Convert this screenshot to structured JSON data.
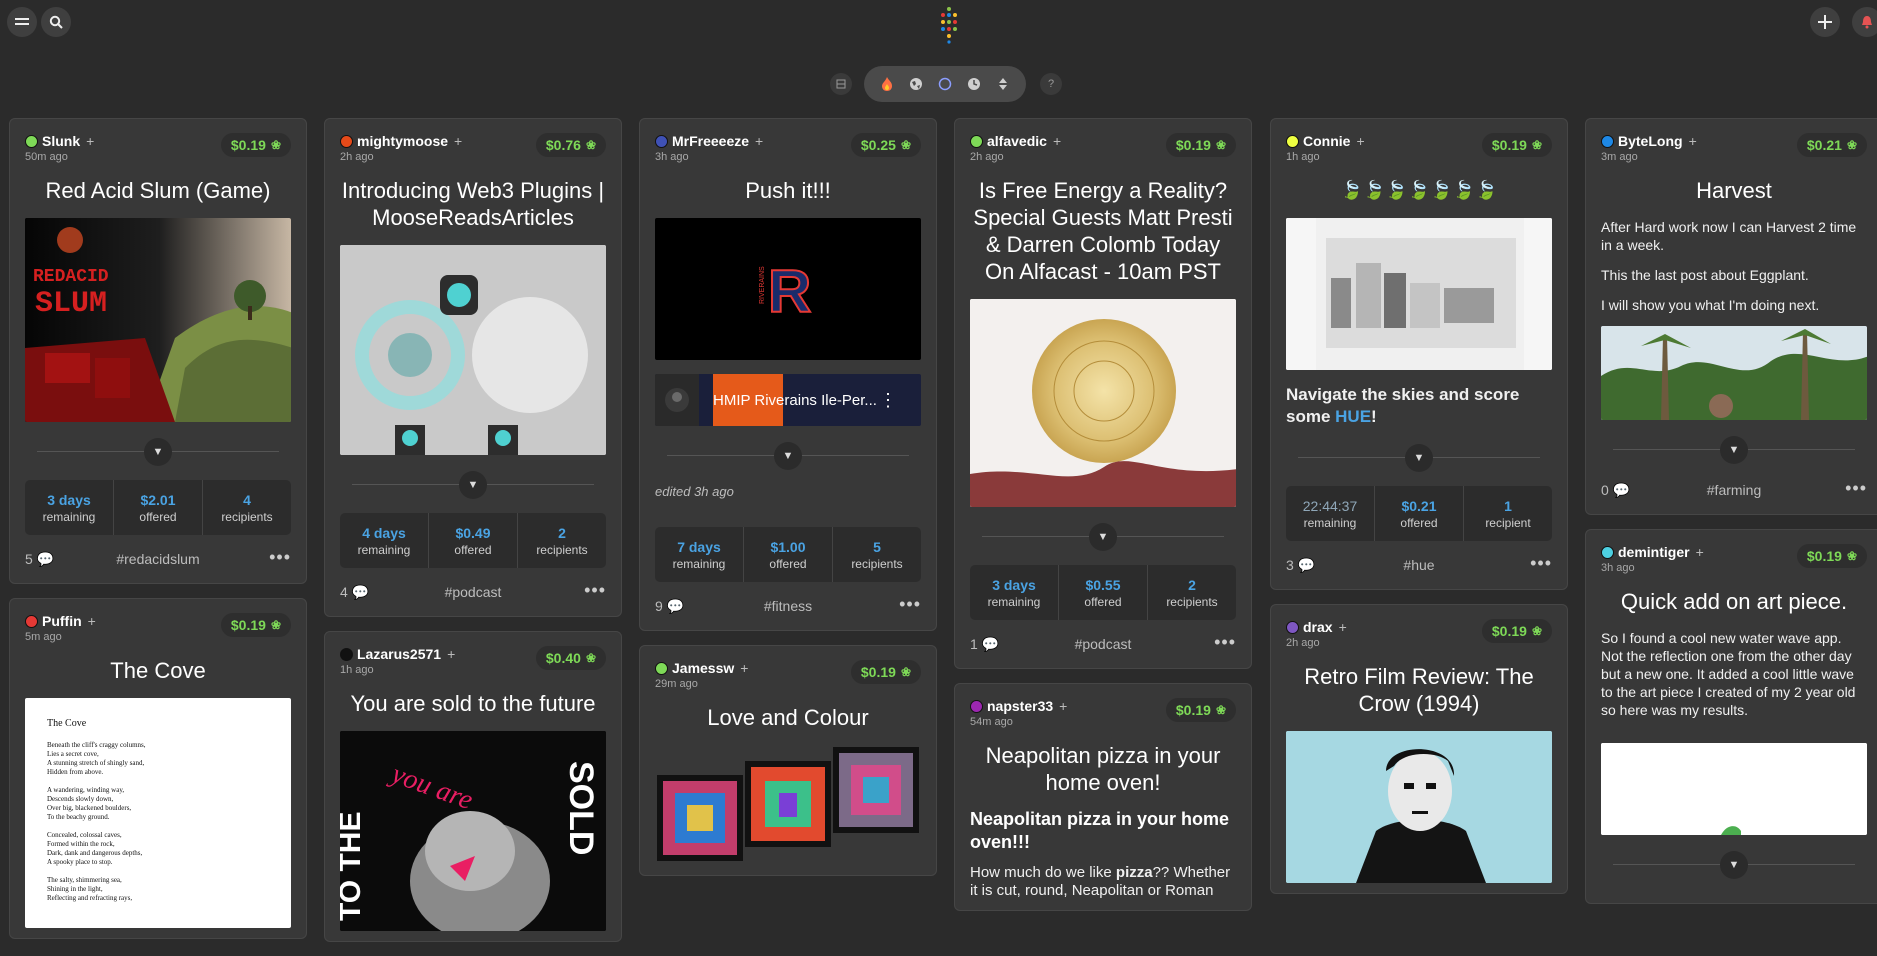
{
  "topbar": {
    "menu_icon": "menu-icon",
    "search_icon": "search-icon",
    "add_icon": "plus-icon",
    "notify_icon": "bell-icon"
  },
  "filterbar": {
    "icons": [
      "layout-icon",
      "fire-icon",
      "globe-icon",
      "circle-icon",
      "clock-icon",
      "sort-icon",
      "help-icon"
    ],
    "help_label": "?"
  },
  "cards": {
    "slunk": {
      "user": "Slunk",
      "ago": "50m ago",
      "price": "$0.19",
      "title": "Red Acid Slum (Game)",
      "stats": [
        {
          "v": "3 days",
          "l": "remaining"
        },
        {
          "v": "$2.01",
          "l": "offered"
        },
        {
          "v": "4",
          "l": "recipients"
        }
      ],
      "comments": "5",
      "tag": "#redacidslum",
      "media_text": "REDACID\nSLUM",
      "color": "#7ed957"
    },
    "puffin": {
      "user": "Puffin",
      "ago": "5m ago",
      "price": "$0.19",
      "title": "The Cove",
      "color": "#e53935",
      "poem_title": "The Cove",
      "poem": "Beneath the cliff's craggy columns,\nLies a secret cove,\nA stunning stretch of shingly sand,\nHidden from above.\n\nA wandering, winding way,\nDescends slowly down,\nOver big, blackened boulders,\nTo the beachy ground.\n\nConcealed, colossal caves,\nFormed within the rock,\nDark, dank and dangerous depths,\nA spooky place to stop.\n\nThe salty, shimmering sea,\nShining in the light,\nReflecting and refracting rays,"
    },
    "moose": {
      "user": "mightymoose",
      "ago": "2h ago",
      "price": "$0.76",
      "title": "Introducing Web3 Plugins | MooseReadsArticles",
      "stats": [
        {
          "v": "4 days",
          "l": "remaining"
        },
        {
          "v": "$0.49",
          "l": "offered"
        },
        {
          "v": "2",
          "l": "recipients"
        }
      ],
      "comments": "4",
      "tag": "#podcast",
      "color": "#e64a19"
    },
    "lazarus": {
      "user": "Lazarus2571",
      "ago": "1h ago",
      "price": "$0.40",
      "title": "You are sold to the future",
      "color": "#111111",
      "art_text": "SOLD",
      "art_text2": "TO THE",
      "art_script": "you are"
    },
    "freeze": {
      "user": "MrFreeeeze",
      "ago": "3h ago",
      "price": "$0.25",
      "title": "Push it!!!",
      "video_title": "HMIP Riverains Ile-Per...",
      "badge_letter": "R",
      "badge_text": "RIVERAINS",
      "edited": "edited 3h ago",
      "stats": [
        {
          "v": "7 days",
          "l": "remaining"
        },
        {
          "v": "$1.00",
          "l": "offered"
        },
        {
          "v": "5",
          "l": "recipients"
        }
      ],
      "comments": "9",
      "tag": "#fitness",
      "color": "#3f51b5"
    },
    "jamessw": {
      "user": "Jamessw",
      "ago": "29m ago",
      "price": "$0.19",
      "title": "Love and Colour",
      "color": "#7ed957"
    },
    "alfa": {
      "user": "alfavedic",
      "ago": "2h ago",
      "price": "$0.19",
      "title": "Is Free Energy a Reality? Special Guests Matt Presti & Darren Colomb Today On Alfacast - 10am PST",
      "stats": [
        {
          "v": "3 days",
          "l": "remaining"
        },
        {
          "v": "$0.55",
          "l": "offered"
        },
        {
          "v": "2",
          "l": "recipients"
        }
      ],
      "comments": "1",
      "tag": "#podcast",
      "color": "#7ed957"
    },
    "napster": {
      "user": "napster33",
      "ago": "54m ago",
      "price": "$0.19",
      "title": "Neapolitan pizza in your home oven!",
      "subtitle": "Neapolitan pizza in your home oven!!!",
      "body_pre": "How much do we like ",
      "body_bold": "pizza",
      "body_post": "?? Whether it is cut, round, Neapolitan or Roman",
      "color": "#9c27b0"
    },
    "connie": {
      "user": "Connie",
      "ago": "1h ago",
      "price": "$0.19",
      "title": "🍃🍃🍃🍃🍃🍃🍃",
      "body_pre": "Navigate the skies and score some ",
      "body_link": "HUE",
      "body_post": "!",
      "stats": [
        {
          "v": "22:44:37",
          "l": "remaining"
        },
        {
          "v": "$0.21",
          "l": "offered"
        },
        {
          "v": "1",
          "l": "recipient"
        }
      ],
      "comments": "3",
      "tag": "#hue",
      "color": "#eeff41"
    },
    "drax": {
      "user": "drax",
      "ago": "2h ago",
      "price": "$0.19",
      "title": "Retro Film Review: The Crow (1994)",
      "color": "#7e57c2"
    },
    "bytelong": {
      "user": "ByteLong",
      "ago": "3m ago",
      "price": "$0.21",
      "title": "Harvest",
      "paras": [
        "After Hard work now I can Harvest 2 time in a week.",
        "This the last post about Eggplant.",
        "I will show you what I'm doing next."
      ],
      "comments": "0",
      "tag": "#farming",
      "color": "#1e88e5"
    },
    "demintiger": {
      "user": "demintiger",
      "ago": "3h ago",
      "price": "$0.19",
      "title": "Quick add on art piece.",
      "body": "So I found a cool new water wave app. Not the reflection one from the other day but a new one. It added a cool little wave to the art piece I created of my 2 year old so here was my results.",
      "color": "#4dd0e1"
    }
  },
  "more_label": "•••"
}
